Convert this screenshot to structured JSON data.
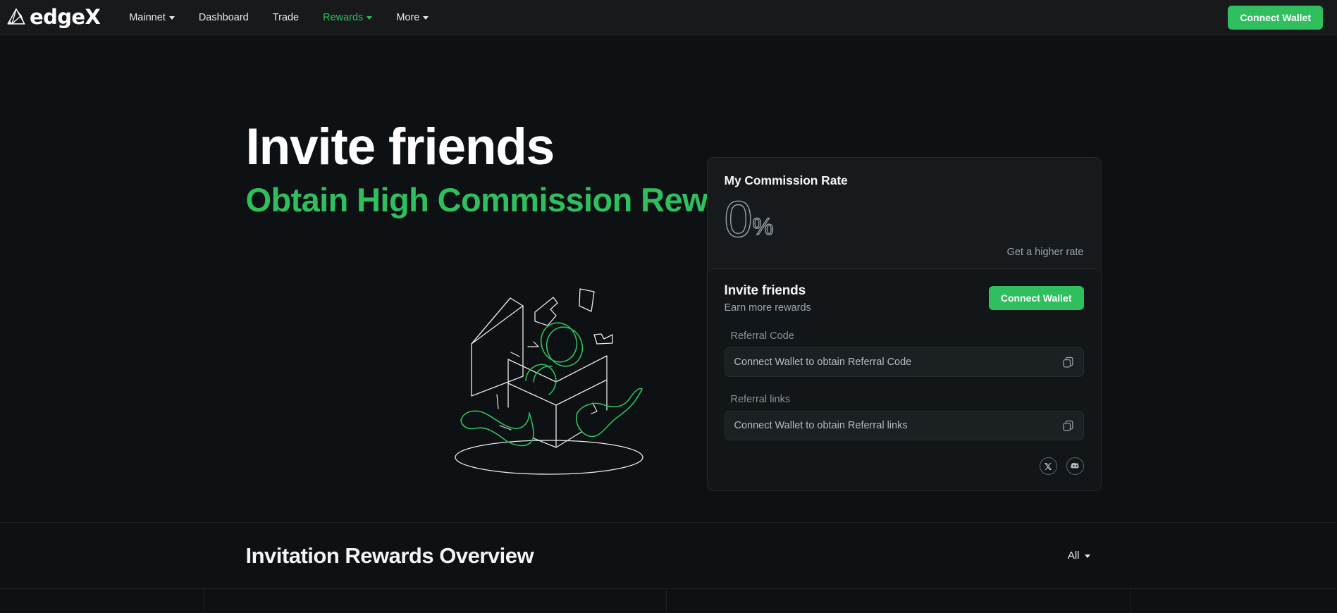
{
  "brand": {
    "name": "edgeX",
    "logo_icon": "edgex-triangle-logo"
  },
  "nav": {
    "items": [
      {
        "label": "Mainnet",
        "has_caret": true,
        "active": false
      },
      {
        "label": "Dashboard",
        "has_caret": false,
        "active": false
      },
      {
        "label": "Trade",
        "has_caret": false,
        "active": false
      },
      {
        "label": "Rewards",
        "has_caret": true,
        "active": true
      },
      {
        "label": "More",
        "has_caret": true,
        "active": false
      }
    ],
    "connect_wallet_label": "Connect Wallet"
  },
  "hero": {
    "title": "Invite friends",
    "subtitle": "Obtain High Commission Rewards",
    "illustration": "gift-box-line-art"
  },
  "commission_card": {
    "label": "My Commission Rate",
    "value": "0",
    "unit": "%",
    "higher_rate_link": "Get a higher rate"
  },
  "invite_panel": {
    "title": "Invite friends",
    "subtitle": "Earn more rewards",
    "connect_wallet_label": "Connect Wallet",
    "referral_code": {
      "label": "Referral Code",
      "value": "Connect Wallet to obtain Referral Code",
      "copy_icon": "copy-icon"
    },
    "referral_links": {
      "label": "Referral links",
      "value": "Connect Wallet to obtain Referral links",
      "copy_icon": "copy-icon"
    },
    "socials": [
      {
        "name": "x-twitter",
        "title": "X"
      },
      {
        "name": "discord",
        "title": "Discord"
      }
    ]
  },
  "overview": {
    "title": "Invitation Rewards Overview",
    "filter_value": "All"
  },
  "colors": {
    "accent_green": "#2fbf5e",
    "page_bg": "#0d1113",
    "nav_bg": "#17191b",
    "card_bg": "#161a1c",
    "panel_bg": "#121618",
    "input_bg": "#1b2023",
    "text_primary": "#f2f4f5",
    "text_muted": "#9ea5aa",
    "border": "#26292b"
  }
}
